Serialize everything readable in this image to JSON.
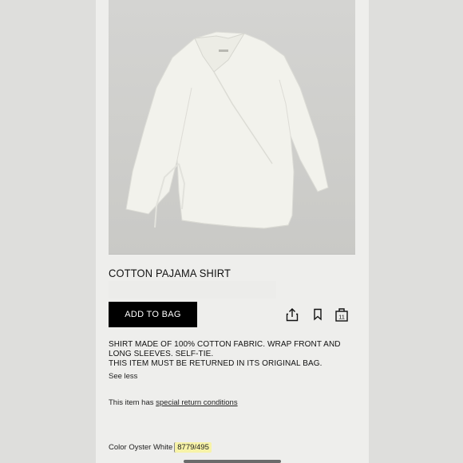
{
  "product": {
    "title": "COTTON PAJAMA SHIRT",
    "image_icon": "shirt-photo"
  },
  "actions": {
    "add_to_bag_label": "ADD TO BAG",
    "share_icon": "share-icon",
    "bookmark_icon": "bookmark-icon",
    "bag_icon": "bag-icon",
    "bag_count": "11"
  },
  "description": {
    "line1": "SHIRT MADE OF 100% COTTON FABRIC. WRAP FRONT AND LONG SLEEVES. SELF-TIE.",
    "line2": "THIS ITEM MUST BE RETURNED IN ITS ORIGINAL BAG.",
    "see_less": "See less"
  },
  "returns": {
    "prefix": "This item has ",
    "link": "special return conditions"
  },
  "color": {
    "label": "Color Oyster White",
    "separator": "|",
    "reference": "8779/495"
  },
  "colors": {
    "button_bg": "#000000",
    "highlight": "#f7f3a8"
  }
}
